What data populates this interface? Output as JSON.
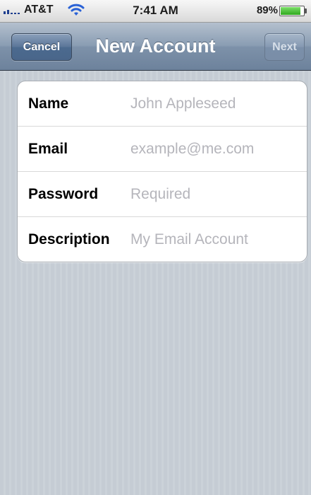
{
  "status_bar": {
    "carrier": "AT&T",
    "time": "7:41 AM",
    "battery_percent": "89%",
    "battery_level": 0.89,
    "signal_icon": "signal-bars-icon",
    "wifi_icon": "wifi-icon",
    "battery_icon": "battery-icon"
  },
  "nav_bar": {
    "title": "New Account",
    "cancel_label": "Cancel",
    "next_label": "Next"
  },
  "form": {
    "fields": [
      {
        "label": "Name",
        "value": "",
        "placeholder": "John Appleseed"
      },
      {
        "label": "Email",
        "value": "",
        "placeholder": "example@me.com"
      },
      {
        "label": "Password",
        "value": "",
        "placeholder": "Required"
      },
      {
        "label": "Description",
        "value": "",
        "placeholder": "My Email Account"
      }
    ]
  },
  "colors": {
    "nav_bar": "#7d91a9",
    "cancel_button": "#4b6a8f",
    "next_button_disabled": "#8599b2",
    "background": "#c5ccd4",
    "placeholder": "#b5b5bb",
    "battery_fill": "#2fa81d"
  }
}
